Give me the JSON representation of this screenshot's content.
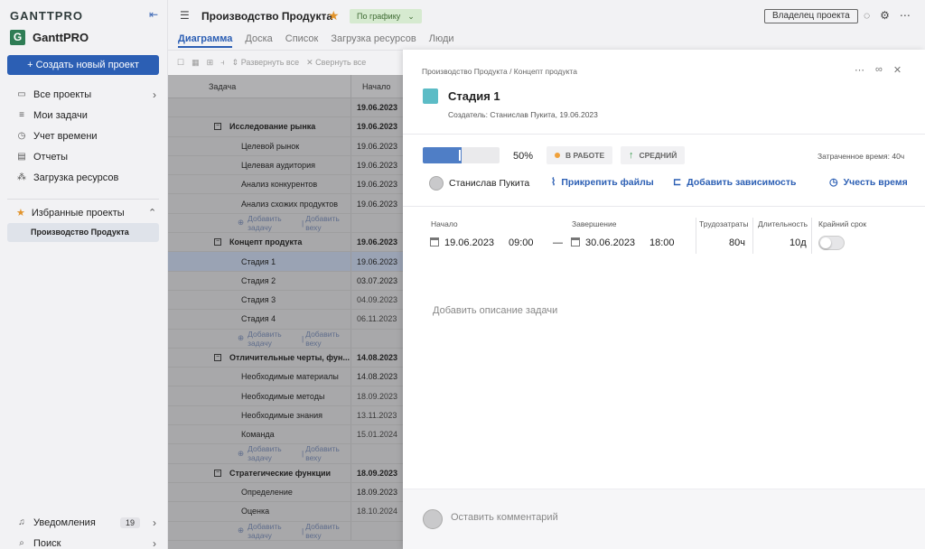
{
  "sidebar": {
    "logo": "GANTTPRO",
    "workspace_letter": "G",
    "workspace_name": "GanttPRO",
    "create_label": "+ Создать новый проект",
    "nav": [
      {
        "icon": "folder-icon",
        "glyph": "▭",
        "label": "Все проекты",
        "chevron": true
      },
      {
        "icon": "list-icon",
        "glyph": "≡",
        "label": "Мои задачи",
        "chevron": false
      },
      {
        "icon": "clock-icon",
        "glyph": "◷",
        "label": "Учет времени",
        "chevron": false
      },
      {
        "icon": "report-icon",
        "glyph": "▤",
        "label": "Отчеты",
        "chevron": false
      },
      {
        "icon": "resources-icon",
        "glyph": "⁂",
        "label": "Загрузка ресурсов",
        "chevron": false
      }
    ],
    "favorites_label": "Избранные проекты",
    "favorites": [
      "Производство Продукта"
    ],
    "notifications_label": "Уведомления",
    "notifications_count": "19",
    "search_label": "Поиск"
  },
  "header": {
    "project_title": "Производство Продукта",
    "status": "По графику",
    "owner_label": "Владелец проекта",
    "tabs": [
      "Диаграмма",
      "Доска",
      "Список",
      "Загрузка ресурсов",
      "Люди"
    ],
    "active_tab": "Диаграмма"
  },
  "toolbar": {
    "expand_label": "Развернуть все",
    "collapse_label": "Свернуть все"
  },
  "grid": {
    "col_task": "Задача",
    "col_start": "Начало",
    "project_row_date": "19.06.2023",
    "rows": [
      {
        "type": "group",
        "name": "Исследование рынка",
        "date": "19.06.2023"
      },
      {
        "type": "task",
        "name": "Целевой рынок",
        "date": "19.06.2023"
      },
      {
        "type": "task",
        "name": "Целевая аудитория",
        "date": "19.06.2023"
      },
      {
        "type": "task",
        "name": "Анализ конкурентов",
        "date": "19.06.2023"
      },
      {
        "type": "task",
        "name": "Анализ схожих продуктов",
        "date": "19.06.2023"
      },
      {
        "type": "add"
      },
      {
        "type": "group",
        "name": "Концепт продукта",
        "date": "19.06.2023"
      },
      {
        "type": "task",
        "name": "Стадия 1",
        "date": "19.06.2023",
        "selected": true
      },
      {
        "type": "task",
        "name": "Стадия 2",
        "date": "03.07.2023"
      },
      {
        "type": "task",
        "name": "Стадия 3",
        "date": "04.09.2023",
        "muted": true
      },
      {
        "type": "task",
        "name": "Стадия 4",
        "date": "06.11.2023",
        "muted": true
      },
      {
        "type": "add"
      },
      {
        "type": "group",
        "name": "Отличительные черты, фун...",
        "date": "14.08.2023"
      },
      {
        "type": "task",
        "name": "Необходимые материалы",
        "date": "14.08.2023"
      },
      {
        "type": "task",
        "name": "Необходимые методы",
        "date": "18.09.2023",
        "muted": true
      },
      {
        "type": "task",
        "name": "Необходимые знания",
        "date": "13.11.2023",
        "muted": true
      },
      {
        "type": "task",
        "name": "Команда",
        "date": "15.01.2024",
        "muted": true
      },
      {
        "type": "add"
      },
      {
        "type": "group",
        "name": "Стратегические функции",
        "date": "18.09.2023"
      },
      {
        "type": "task",
        "name": "Определение",
        "date": "18.09.2023"
      },
      {
        "type": "task",
        "name": "Оценка",
        "date": "18.10.2024",
        "muted": true
      },
      {
        "type": "add"
      }
    ],
    "add_task_label": "Добавить задачу",
    "add_milestone_label": "Добавить веху"
  },
  "panel": {
    "breadcrumb": "Производство Продукта / Концепт продукта",
    "task_color": "#5cbcc6",
    "task_title": "Стадия 1",
    "creator": "Создатель: Станислав Пукита, 19.06.2023",
    "progress_pct": 50,
    "progress_label": "50%",
    "status_chip": "В РАБОТЕ",
    "priority_chip": "СРЕДНИЙ",
    "time_spent": "Затраченное время: 40ч",
    "assignee": "Станислав Пукита",
    "attach_label": "Прикрепить файлы",
    "dependency_label": "Добавить зависимость",
    "track_time_label": "Учесть время",
    "start_label": "Начало",
    "start_date": "19.06.2023",
    "start_time": "09:00",
    "end_label": "Завершение",
    "end_date": "30.06.2023",
    "end_time": "18:00",
    "effort_label": "Трудозатраты",
    "effort_value": "80ч",
    "duration_label": "Длительность",
    "duration_value": "10д",
    "deadline_label": "Крайний срок",
    "description_placeholder": "Добавить описание задачи",
    "comment_placeholder": "Оставить комментарий"
  }
}
